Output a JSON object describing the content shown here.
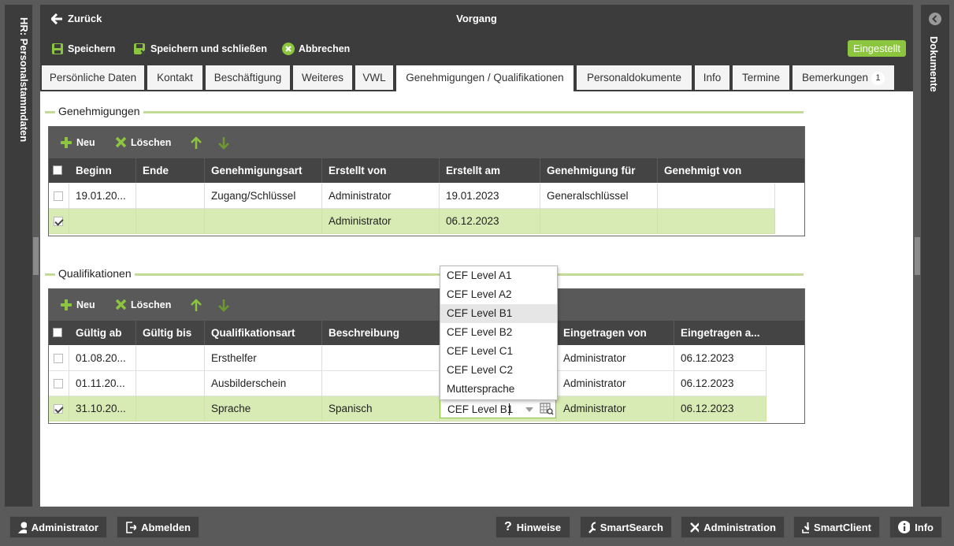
{
  "sidebar_left": {
    "label": "HR: Personalstammdaten"
  },
  "sidebar_right": {
    "label": "Dokumente"
  },
  "header": {
    "back_label": "Zurück",
    "title": "Vorgang"
  },
  "toolbar": {
    "save_label": "Speichern",
    "save_close_label": "Speichern und schließen",
    "cancel_label": "Abbrechen",
    "status_label": "Eingestellt"
  },
  "tabs": [
    {
      "label": "Persönliche Daten"
    },
    {
      "label": "Kontakt"
    },
    {
      "label": "Beschäftigung"
    },
    {
      "label": "Weiteres"
    },
    {
      "label": "VWL"
    },
    {
      "label": "Genehmigungen / Qualifikationen"
    },
    {
      "label": "Personaldokumente"
    },
    {
      "label": "Info"
    },
    {
      "label": "Termine"
    },
    {
      "label": "Bemerkungen",
      "badge": "1"
    }
  ],
  "genehmigungen": {
    "title": "Genehmigungen",
    "new_label": "Neu",
    "delete_label": "Löschen",
    "columns": [
      "Beginn",
      "Ende",
      "Genehmigungsart",
      "Erstellt von",
      "Erstellt am",
      "Genehmigung für",
      "Genehmigt von"
    ],
    "rows": [
      {
        "checked": false,
        "cells": [
          "19.01.20...",
          "",
          "Zugang/Schlüssel",
          "Administrator",
          "19.01.2023",
          "Generalschlüssel",
          ""
        ]
      },
      {
        "checked": true,
        "cells": [
          "",
          "",
          "",
          "Administrator",
          "06.12.2023",
          "",
          ""
        ]
      }
    ]
  },
  "qualifikationen": {
    "title": "Qualifikationen",
    "new_label": "Neu",
    "delete_label": "Löschen",
    "columns": [
      "Gültig ab",
      "Gültig bis",
      "Qualifikationsart",
      "Beschreibung",
      "",
      "Eingetragen von",
      "Eingetragen a..."
    ],
    "rows": [
      {
        "checked": false,
        "cells": [
          "01.08.20...",
          "",
          "Ersthelfer",
          "",
          "",
          "Administrator",
          "06.12.2023"
        ]
      },
      {
        "checked": false,
        "cells": [
          "01.11.20...",
          "",
          "Ausbilderschein",
          "",
          "",
          "Administrator",
          "06.12.2023"
        ]
      },
      {
        "checked": true,
        "cells": [
          "31.10.20...",
          "",
          "Sprache",
          "Spanisch",
          "",
          "Administrator",
          "06.12.2023"
        ]
      }
    ],
    "combo_value": "CEF Level B1",
    "dropdown_options": [
      "CEF Level A1",
      "CEF Level A2",
      "CEF Level B1",
      "CEF Level B2",
      "CEF Level C1",
      "CEF Level C2",
      "Muttersprache"
    ],
    "dropdown_highlighted": "CEF Level B1"
  },
  "footer": {
    "user_label": "Administrator",
    "logout_label": "Abmelden",
    "hints_label": "Hinweise",
    "smartsearch_label": "SmartSearch",
    "administration_label": "Administration",
    "smartclient_label": "SmartClient",
    "info_label": "Info"
  },
  "colors": {
    "accent": "#8cc63f",
    "dark": "#3c3c3c",
    "header": "#444444",
    "selected_row": "#d9ebb4"
  }
}
